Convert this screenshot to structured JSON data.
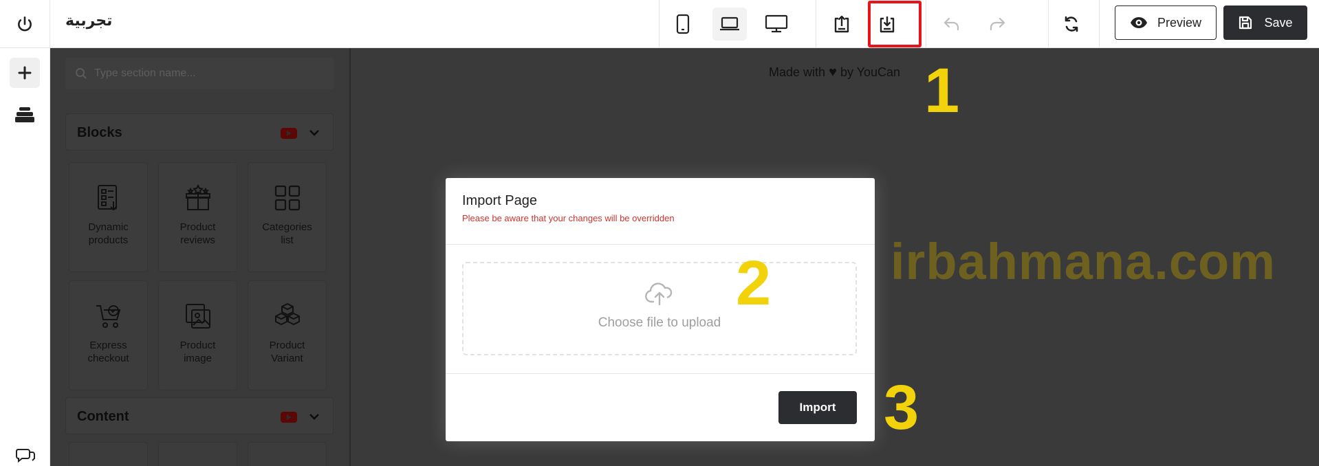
{
  "topbar": {
    "page_name": "تجربية",
    "preview_label": "Preview",
    "save_label": "Save"
  },
  "sidebar": {
    "search_placeholder": "Type section name...",
    "categories": [
      {
        "label": "Blocks"
      },
      {
        "label": "Content"
      }
    ],
    "blocks": [
      {
        "label": "Dynamic products",
        "icon": "dynamic-products-icon"
      },
      {
        "label": "Product reviews",
        "icon": "product-reviews-icon"
      },
      {
        "label": "Categories list",
        "icon": "categories-list-icon"
      },
      {
        "label": "Express checkout",
        "icon": "express-checkout-icon"
      },
      {
        "label": "Product image",
        "icon": "product-image-icon"
      },
      {
        "label": "Product Variant",
        "icon": "product-variant-icon"
      }
    ]
  },
  "canvas": {
    "made_with_prefix": "Made with",
    "made_with_suffix": "by YouCan",
    "watermark": "irbahmana.com"
  },
  "modal": {
    "title": "Import Page",
    "warning": "Please be aware that your changes will be overridden",
    "dropzone_label": "Choose file to upload",
    "import_label": "Import"
  },
  "annotations": {
    "step1": "1",
    "step2": "2",
    "step3": "3",
    "highlight_color": "#e8141c",
    "step_color": "#f2d20a"
  }
}
